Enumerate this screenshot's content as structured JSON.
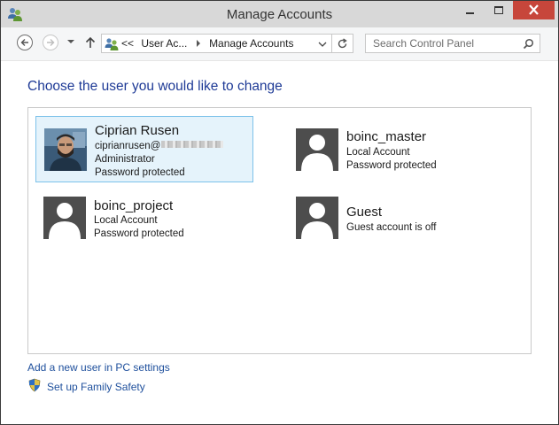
{
  "window": {
    "title": "Manage Accounts"
  },
  "nav": {
    "breadcrumb": [
      "User Ac...",
      "Manage Accounts"
    ],
    "overflow_marker": "<<",
    "search_placeholder": "Search Control Panel"
  },
  "main": {
    "heading": "Choose the user you would like to change",
    "accounts": [
      {
        "name": "Ciprian Rusen",
        "line1": "ciprianrusen@",
        "line2": "Administrator",
        "line3": "Password protected",
        "selected": true,
        "avatar": "user-photo"
      },
      {
        "name": "boinc_master",
        "line1": "Local Account",
        "line2": "Password protected",
        "selected": false,
        "avatar": "default-user-icon"
      },
      {
        "name": "boinc_project",
        "line1": "Local Account",
        "line2": "Password protected",
        "selected": false,
        "avatar": "default-user-icon"
      },
      {
        "name": "Guest",
        "line1": "Guest account is off",
        "selected": false,
        "avatar": "default-user-icon"
      }
    ],
    "links": {
      "add_user": "Add a new user in PC settings",
      "family_safety": "Set up Family Safety"
    }
  },
  "colors": {
    "accent_link": "#1e4f9c",
    "heading": "#1e3a96",
    "selection_bg": "#e5f3fb",
    "selection_border": "#7dc2ea",
    "close_button": "#c7463b"
  }
}
